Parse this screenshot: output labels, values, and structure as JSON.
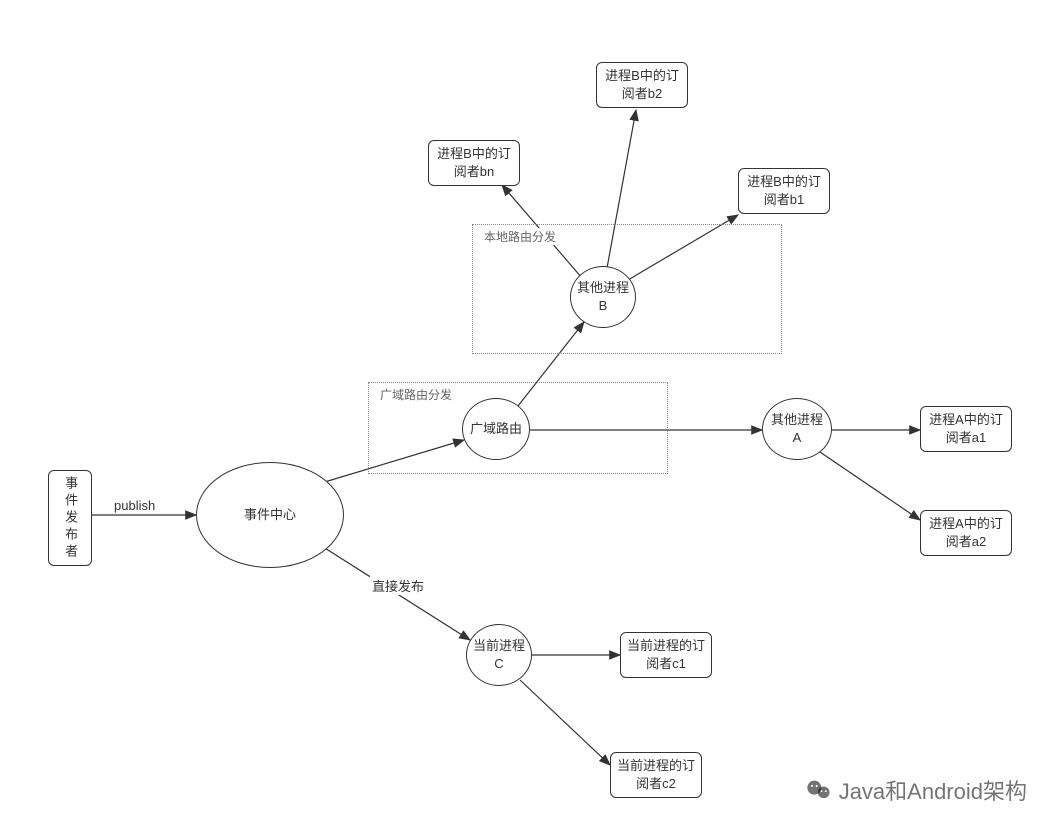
{
  "nodes": {
    "publisher": "事件发布者",
    "event_center": "事件中心",
    "wan_router": "广域路由",
    "wan_box_label": "广域路由分发",
    "local_box_label": "本地路由分发",
    "process_b": "其他进程B",
    "process_a": "其他进程A",
    "process_c": "当前进程C",
    "sub_b1": "进程B中的订阅者b1",
    "sub_b2": "进程B中的订阅者b2",
    "sub_bn": "进程B中的订阅者bn",
    "sub_a1": "进程A中的订阅者a1",
    "sub_a2": "进程A中的订阅者a2",
    "sub_c1": "当前进程的订阅者c1",
    "sub_c2": "当前进程的订阅者c2"
  },
  "edges": {
    "publish": "publish",
    "direct_publish": "直接发布"
  },
  "watermark": "Java和Android架构"
}
